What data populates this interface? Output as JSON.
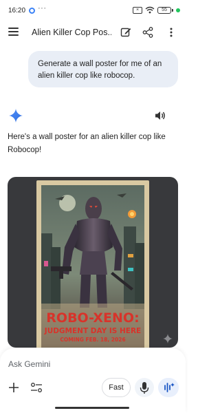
{
  "status_bar": {
    "time": "16:20",
    "more": "···",
    "sim_label": "×",
    "battery": "55"
  },
  "header": {
    "title": "Alien Killer Cop Pos...",
    "icons": [
      "menu-icon",
      "edit-icon",
      "share-icon",
      "more-vert-icon"
    ]
  },
  "conversation": {
    "user_prompt": "Generate a wall poster for me of an alien killer cop like robocop.",
    "response_text": "Here's a wall poster for an alien killer cop like Robocop!",
    "icons": [
      "gemini-sparkle-icon",
      "speaker-icon"
    ]
  },
  "poster": {
    "title_line": "ROBO-XENO:",
    "subtitle": "JUDGMENT DAY IS HERE",
    "date_line": "COMING FEB. 18, 2026",
    "colors": {
      "title": "#d8332a",
      "paper": "#d9c9a2",
      "city": "#3f4a45",
      "sky": "#6e7a6a"
    }
  },
  "input_bar": {
    "placeholder": "Ask Gemini",
    "model_button": "Fast",
    "icons": [
      "plus-icon",
      "tools-icon",
      "mic-icon",
      "live-icon"
    ]
  }
}
